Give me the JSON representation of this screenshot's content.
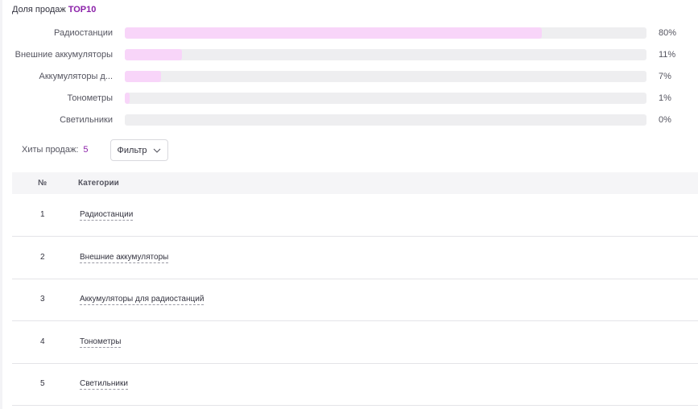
{
  "share": {
    "title": "Доля продаж",
    "title_accent": "TOP10",
    "rows": [
      {
        "label": "Радиостанции",
        "percent": "80%",
        "value": 0.8
      },
      {
        "label": "Внешние аккумуляторы",
        "percent": "11%",
        "value": 0.11
      },
      {
        "label": "Аккумуляторы д...",
        "percent": "7%",
        "value": 0.07
      },
      {
        "label": "Тонометры",
        "percent": "1%",
        "value": 0.01
      },
      {
        "label": "Светильники",
        "percent": "0%",
        "value": 0.0
      }
    ],
    "colors": {
      "fill": "#f8d5f9",
      "track": "#eeeef0",
      "accent": "#8a1fa8"
    }
  },
  "hits": {
    "label": "Хиты продаж:",
    "count": "5",
    "filter_label": "Фильтр",
    "filter_icon": "chevron-down-icon"
  },
  "table": {
    "headers": {
      "num": "№",
      "category": "Категории"
    },
    "rows": [
      {
        "num": "1",
        "category": "Радиостанции"
      },
      {
        "num": "2",
        "category": "Внешние аккумуляторы"
      },
      {
        "num": "3",
        "category": "Аккумуляторы для радиостанций"
      },
      {
        "num": "4",
        "category": "Тонометры"
      },
      {
        "num": "5",
        "category": "Светильники"
      }
    ]
  }
}
